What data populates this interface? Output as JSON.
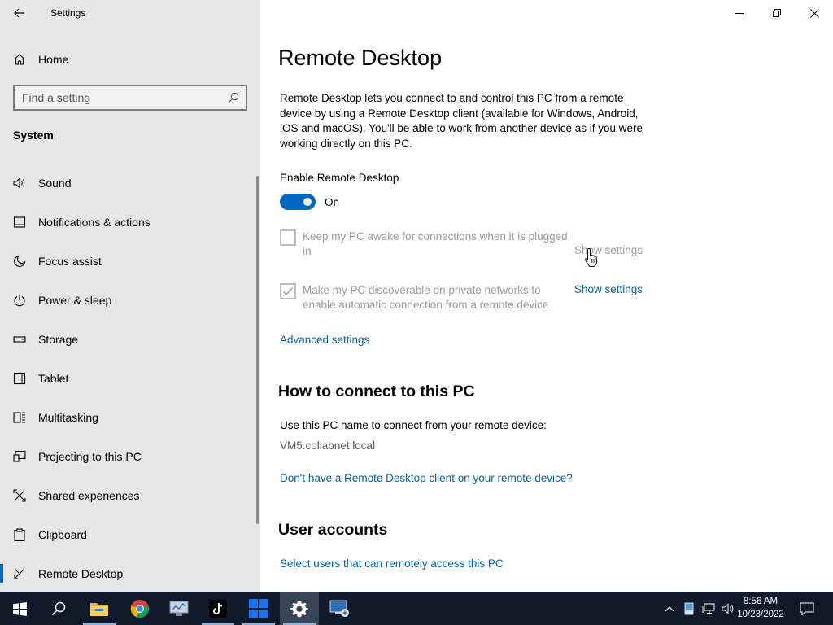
{
  "window": {
    "title": "Settings"
  },
  "sidebar": {
    "home_label": "Home",
    "search_placeholder": "Find a setting",
    "section": "System",
    "items": [
      {
        "label": "Sound",
        "icon": "speaker-icon"
      },
      {
        "label": "Notifications & actions",
        "icon": "notification-icon"
      },
      {
        "label": "Focus assist",
        "icon": "moon-icon"
      },
      {
        "label": "Power & sleep",
        "icon": "power-icon"
      },
      {
        "label": "Storage",
        "icon": "storage-icon"
      },
      {
        "label": "Tablet",
        "icon": "tablet-icon"
      },
      {
        "label": "Multitasking",
        "icon": "multitasking-icon"
      },
      {
        "label": "Projecting to this PC",
        "icon": "projecting-icon"
      },
      {
        "label": "Shared experiences",
        "icon": "shared-experiences-icon"
      },
      {
        "label": "Clipboard",
        "icon": "clipboard-icon"
      },
      {
        "label": "Remote Desktop",
        "icon": "remote-desktop-icon",
        "active": true
      }
    ]
  },
  "main": {
    "title": "Remote Desktop",
    "description": "Remote Desktop lets you connect to and control this PC from a remote device by using a Remote Desktop client (available for Windows, Android, iOS and macOS). You'll be able to work from another device as if you were working directly on this PC.",
    "enable_label": "Enable Remote Desktop",
    "toggle_state": "On",
    "toggle_on": true,
    "options": [
      {
        "text": "Keep my PC awake for connections when it is plugged in",
        "checked": false,
        "link": "Show settings"
      },
      {
        "text": "Make my PC discoverable on private networks to enable automatic connection from a remote device",
        "checked": true,
        "link": "Show settings"
      }
    ],
    "advanced_link": "Advanced settings",
    "connect_heading": "How to connect to this PC",
    "connect_text": "Use this PC name to connect from your remote device:",
    "pc_name": "VM5.collabnet.local",
    "client_link": "Don't have a Remote Desktop client on your remote device?",
    "accounts_heading": "User accounts",
    "accounts_link": "Select users that can remotely access this PC"
  },
  "taskbar": {
    "time": "8:56 AM",
    "date": "10/23/2022",
    "apps": [
      "start-icon",
      "search-icon",
      "file-explorer-icon",
      "chrome-icon",
      "server-manager-icon",
      "tiktok-icon",
      "windows-tiles-icon",
      "settings-icon",
      "remote-desktop-app-icon"
    ]
  },
  "colors": {
    "accent": "#0067c0",
    "link": "#0063b1",
    "sidebar_bg": "#e6e6e6",
    "taskbar_bg": "#101a2b"
  }
}
